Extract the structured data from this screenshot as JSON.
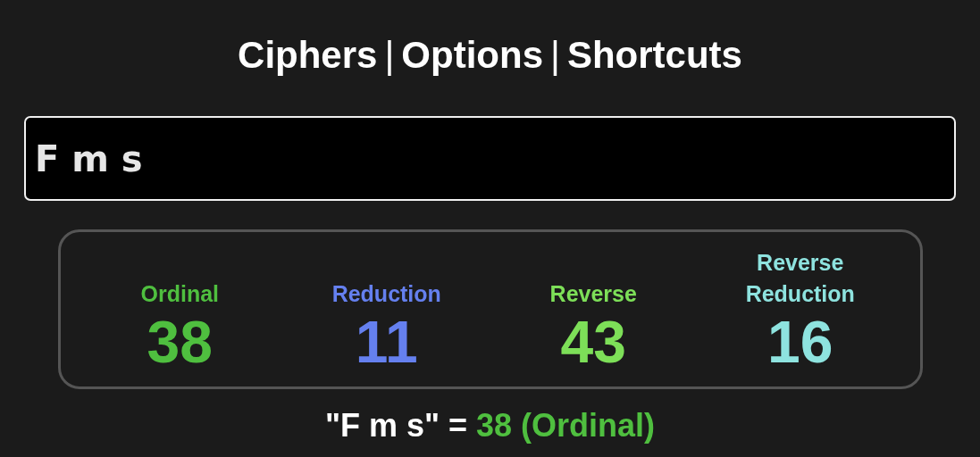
{
  "nav": [
    {
      "kind": "link",
      "text": "Ciphers"
    },
    {
      "kind": "separator",
      "text": "|"
    },
    {
      "kind": "link",
      "text": "Options"
    },
    {
      "kind": "separator",
      "text": "|"
    },
    {
      "kind": "link",
      "text": "Shortcuts"
    }
  ],
  "input": {
    "value": "F m s"
  },
  "ciphers": [
    {
      "name": "Ordinal",
      "value": "38",
      "color": "#4fbf3f"
    },
    {
      "name": "Reduction",
      "value": "11",
      "color": "#6580ef"
    },
    {
      "name": "Reverse",
      "value": "43",
      "color": "#7ddf58"
    },
    {
      "name": "Reverse Reduction",
      "value": "16",
      "color": "#8ee3df"
    }
  ],
  "result": {
    "phrase": "\"F m s\" =",
    "value": "38 (Ordinal)",
    "color": "#4fbf3f"
  }
}
